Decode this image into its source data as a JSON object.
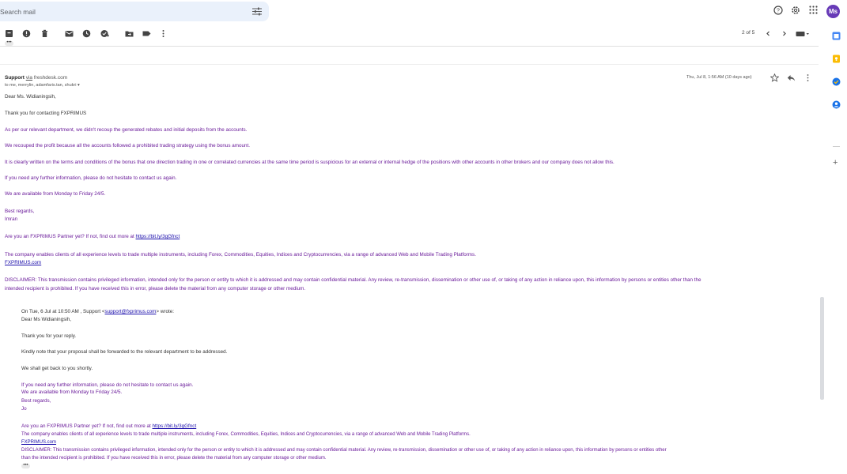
{
  "search": {
    "placeholder": "Search mail"
  },
  "header": {
    "avatar_initials": "Ms"
  },
  "toolbar": {
    "pager": "2 of 5"
  },
  "collapsed": {
    "label": "•••"
  },
  "message": {
    "sender_name": "Support",
    "via": "via",
    "via_domain": "freshdesk.com",
    "recipients": "to me, merrylin, adamfaris.tan, shukri ▾",
    "datetime": "Thu, Jul 8, 1:56 AM (10 days ago)",
    "body": [
      "Dear Ms. Widianingsih,",
      "Thank you for contacting FXPRIMUS",
      "As per our relevant department, we didn't recoup the generated rebates and initial deposits from the accounts.",
      "We recouped the profit because all the accounts followed a prohibited trading strategy using the bonus amount.",
      "It is clearly written on the terms and conditions of the bonus that one direction trading in one or correlated currencies at the same time period is suspicious for an external or internal hedge of the positions with other accounts in other brokers and our company does not allow this.",
      "If you need any further information, please do not hesitate to contact us again.",
      "We are available from Monday to Friday 24/5.",
      "Best regards,",
      "Imran"
    ],
    "partner_text": "Are you an FXPRIMUS Partner yet? If not, find out more at ",
    "partner_link": "https://bit.ly/3gGfnct",
    "company_text": "The company enables clients of all experience levels to trade multiple instruments, including Forex, Commodities, Equities, Indices and Cryptocurrencies, via a range of advanced Web and Mobile Trading Platforms.",
    "company_link": "FXPRIMUS.com",
    "disclaimer_1": "DISCLAIMER: This transmission contains privileged information, intended only for the person or entity to which it is addressed and may contain confidential material. Any review, re-transmission, dissemination or other use of, or taking of any action in reliance upon, this information by persons or entities other than the",
    "disclaimer_2": "intended recipient is prohibited. If you have received this in error, please delete the material from any computer storage or other medium."
  },
  "quoted": {
    "wrote_prefix": "On Tue, 6 Jul at 10:50 AM , Support <",
    "wrote_email": "support@fxprimus.com",
    "wrote_suffix": "> wrote:",
    "greeting": "Dear Ms Widianingsih,",
    "thanks": "Thank you for your reply.",
    "kindly": "Kindly note that your proposal shall be forwarded to the relevant department to be addressed.",
    "back": "We shall get back to you shortly.",
    "further": "If you need any further information, please do not hesitate to contact us again.",
    "available": "We are available from Monday to Friday 24/5.",
    "regards": "Best regards,",
    "name": "Jo",
    "partner_text": "Are you an FXPRIMUS Partner yet? If not, find out more at ",
    "partner_link": "https://bit.ly/3gGfnct",
    "company_text": "The company enables clients of all experience levels to trade multiple instruments, including Forex, Commodities, Equities, Indices and Cryptocurrencies, via a range of advanced Web and Mobile Trading Platforms.",
    "company_link": "FXPRIMUS.com",
    "disclaimer_1": "DISCLAIMER: This transmission contains privileged information, intended only for the person or entity to which it is addressed and may contain confidential material. Any review, re-transmission, dissemination or other use of, or taking of any action in reliance upon, this information by persons or entities other",
    "disclaimer_2": "than the intended recipient is prohibited. If you have received this in error, please delete the material from any computer storage or other medium.",
    "more": "•••"
  },
  "colors": {
    "avatar": "#673ab7",
    "purple_text": "#6a1b9a",
    "link": "#1a0dab"
  }
}
